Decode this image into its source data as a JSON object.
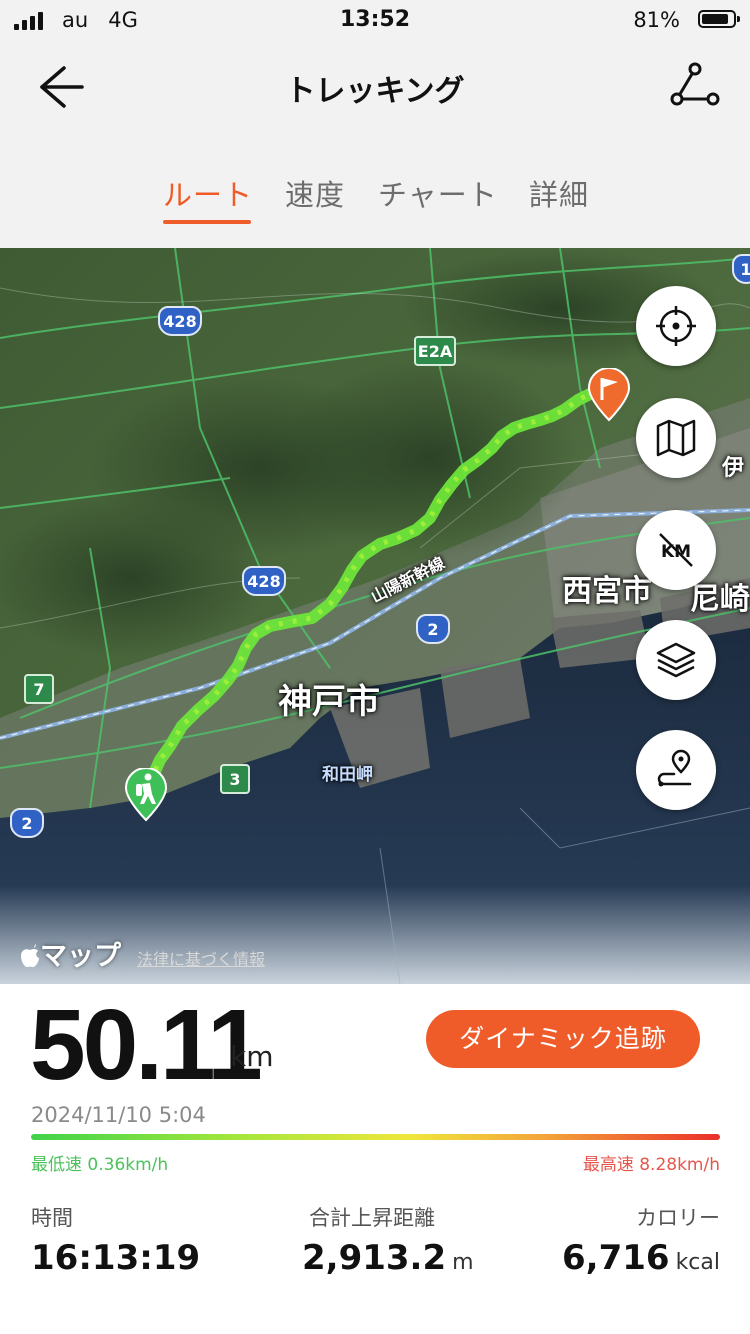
{
  "status_bar": {
    "carrier": "au",
    "network": "4G",
    "time": "13:52",
    "battery": "81%"
  },
  "header": {
    "title": "トレッキング"
  },
  "tabs": [
    {
      "label": "ルート",
      "active": true
    },
    {
      "label": "速度"
    },
    {
      "label": "チャート"
    },
    {
      "label": "詳細"
    }
  ],
  "map": {
    "labels": {
      "kobe": "神戸市",
      "nishinomiya": "西宮市",
      "amagasaki": "尼崎",
      "itami": "伊",
      "wadamisaki": "和田岬",
      "shinkansen": "山陽新幹線"
    },
    "shields": {
      "r428_top": "428",
      "r428_mid": "428",
      "e2a": "E2A",
      "r2_mid": "2",
      "r2_left": "2",
      "r7": "7",
      "r3": "3",
      "r1": "1"
    },
    "attribution": {
      "brand": "マップ",
      "legal": "法律に基づく情報"
    },
    "buttons": [
      "crosshair-icon",
      "map-icon",
      "no-km-icon",
      "layers-icon",
      "route-pin-icon"
    ]
  },
  "summary": {
    "distance": "50.11",
    "distance_unit": "km",
    "dynamic_button": "ダイナミック追跡",
    "datetime": "2024/11/10 5:04",
    "min_speed": "最低速 0.36km/h",
    "max_speed": "最高速 8.28km/h"
  },
  "stats": {
    "time": {
      "label": "時間",
      "value": "16:13:19"
    },
    "ascent": {
      "label": "合計上昇距離",
      "value": "2,913.2",
      "unit": "m"
    },
    "calories": {
      "label": "カロリー",
      "value": "6,716",
      "unit": "kcal"
    }
  },
  "colors": {
    "accent": "#ef5c2a",
    "track": "#7ee62c",
    "min": "#4bc25b",
    "max": "#e5574d"
  }
}
